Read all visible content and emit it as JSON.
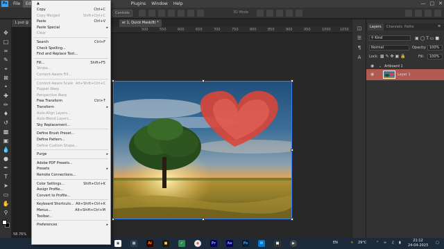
{
  "menubar": {
    "logo": "Ps",
    "items": [
      "File",
      "Edit",
      "Plugins",
      "Window",
      "Help"
    ],
    "active": "Edit"
  },
  "options_bar": {
    "controls_label": "Controls",
    "auto_label": "3D Mode"
  },
  "document": {
    "tab_left": "1.psd @",
    "tab_title": "er 1, Quick Mask/8) *",
    "ruler_ticks": [
      "500",
      "550",
      "600",
      "650",
      "700",
      "750",
      "800",
      "850",
      "900",
      "950",
      "1000",
      "1050"
    ]
  },
  "status_zoom": "58.76%",
  "edit_menu": {
    "sections": [
      [
        {
          "label": "Copy",
          "shortcut": "Ctrl+C",
          "disabled": false
        },
        {
          "label": "Copy Merged",
          "shortcut": "Shift+Ctrl+C",
          "disabled": true
        },
        {
          "label": "Paste",
          "shortcut": "Ctrl+V",
          "disabled": false
        },
        {
          "label": "Paste Special",
          "shortcut": "",
          "submenu": true,
          "disabled": false
        },
        {
          "label": "Clear",
          "shortcut": "",
          "disabled": true
        }
      ],
      [
        {
          "label": "Search",
          "shortcut": "Ctrl+F",
          "disabled": false
        },
        {
          "label": "Check Spelling...",
          "shortcut": "",
          "disabled": false
        },
        {
          "label": "Find and Replace Text...",
          "shortcut": "",
          "disabled": false
        }
      ],
      [
        {
          "label": "Fill...",
          "shortcut": "Shift+F5",
          "disabled": false
        },
        {
          "label": "Stroke...",
          "shortcut": "",
          "disabled": true
        },
        {
          "label": "Content-Aware Fill...",
          "shortcut": "",
          "disabled": true
        }
      ],
      [
        {
          "label": "Content-Aware Scale",
          "shortcut": "Alt+Shift+Ctrl+C",
          "disabled": true
        },
        {
          "label": "Puppet Warp",
          "shortcut": "",
          "disabled": true
        },
        {
          "label": "Perspective Warp",
          "shortcut": "",
          "disabled": true
        },
        {
          "label": "Free Transform",
          "shortcut": "Ctrl+T",
          "disabled": false
        },
        {
          "label": "Transform",
          "shortcut": "",
          "submenu": true,
          "disabled": false
        },
        {
          "label": "Auto-Align Layers...",
          "shortcut": "",
          "disabled": true
        },
        {
          "label": "Auto-Blend Layers...",
          "shortcut": "",
          "disabled": true
        },
        {
          "label": "Sky Replacement...",
          "shortcut": "",
          "disabled": false
        }
      ],
      [
        {
          "label": "Define Brush Preset...",
          "shortcut": "",
          "disabled": false
        },
        {
          "label": "Define Pattern...",
          "shortcut": "",
          "disabled": false
        },
        {
          "label": "Define Custom Shape...",
          "shortcut": "",
          "disabled": true
        }
      ],
      [
        {
          "label": "Purge",
          "shortcut": "",
          "submenu": true,
          "disabled": false
        }
      ],
      [
        {
          "label": "Adobe PDF Presets...",
          "shortcut": "",
          "disabled": false
        },
        {
          "label": "Presets",
          "shortcut": "",
          "submenu": true,
          "disabled": false
        },
        {
          "label": "Remote Connections...",
          "shortcut": "",
          "disabled": false
        }
      ],
      [
        {
          "label": "Color Settings...",
          "shortcut": "Shift+Ctrl+K",
          "disabled": false
        },
        {
          "label": "Assign Profile...",
          "shortcut": "",
          "disabled": false
        },
        {
          "label": "Convert to Profile...",
          "shortcut": "",
          "disabled": false
        }
      ],
      [
        {
          "label": "Keyboard Shortcuts...",
          "shortcut": "Alt+Shift+Ctrl+K",
          "disabled": false
        },
        {
          "label": "Menus...",
          "shortcut": "Alt+Shift+Ctrl+M",
          "disabled": false
        },
        {
          "label": "Toolbar...",
          "shortcut": "",
          "disabled": false
        }
      ],
      [
        {
          "label": "Preferences",
          "shortcut": "",
          "submenu": true,
          "disabled": false
        }
      ]
    ]
  },
  "layers_panel": {
    "tabs": [
      "Layers",
      "Channels",
      "Paths"
    ],
    "kind_label": "Kind",
    "blend_mode": "Normal",
    "opacity_label": "Opacity:",
    "opacity_value": "100%",
    "lock_label": "Lock:",
    "fill_label": "Fill:",
    "fill_value": "100%",
    "artboard_name": "Artboard 1",
    "layer_name": "Layer 1"
  },
  "taskbar": {
    "language": "EN",
    "weather": "29°C",
    "time": "21:12",
    "date": "24-04-2023",
    "apps": [
      "Ai",
      "Pr",
      "Ae",
      "Ps"
    ]
  },
  "colors": {
    "accent": "#31a8ff",
    "selected_layer": "#b05a52",
    "menu_bg": "#f2f2f2"
  }
}
